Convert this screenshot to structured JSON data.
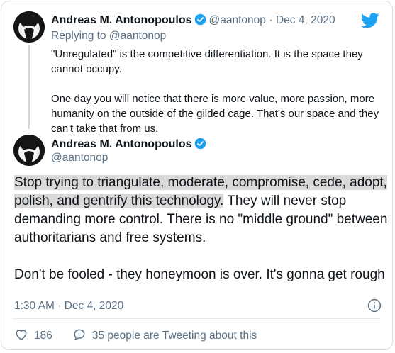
{
  "colors": {
    "accent": "#1da1f2",
    "text": "#0f1419",
    "muted": "#5b7083",
    "highlight": "#d9d9d9"
  },
  "reply_tweet": {
    "author_name": "Andreas M. Antonopoulos",
    "handle": "@aantonop",
    "separator": "·",
    "date": "Dec 4, 2020",
    "replying_prefix": "Replying to",
    "replying_handle": "@aantonop",
    "paragraph_1": "\"Unregulated\" is the competitive differentiation. It is the space they cannot occupy.",
    "paragraph_2": "One day you will notice that there is more value, more passion, more humanity on the outside of the gilded cage. That's our space and they can't take that from us."
  },
  "main_tweet": {
    "author_name": "Andreas M. Antonopoulos",
    "handle": "@aantonop",
    "highlighted_text": "Stop trying to triangulate, moderate, compromise, cede, adopt, polish, and gentrify this technology.",
    "text_rest": " They will never stop demanding more control. There is no \"middle ground\" between authoritarians and free systems.",
    "paragraph_2": "Don't be fooled - they honeymoon is over. It's gonna get rough",
    "timestamp": "1:30 AM · Dec 4, 2020",
    "like_count": "186",
    "replies_label": "35 people are Tweeting about this"
  },
  "icons": {
    "logo": "twitter-bird-icon",
    "verified": "verified-badge-icon",
    "info": "info-icon",
    "like": "heart-icon",
    "reply": "comment-icon"
  }
}
